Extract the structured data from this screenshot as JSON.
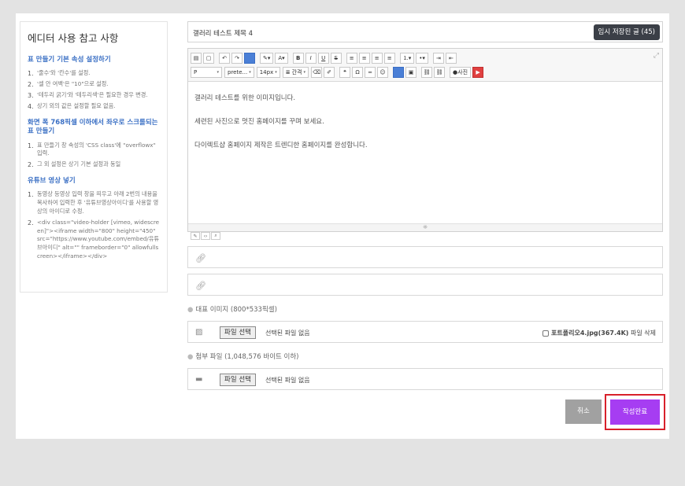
{
  "sidebar": {
    "title": "에디터 사용 참고 사항",
    "sections": [
      {
        "heading": "표 만들기 기본 속성 설정하기",
        "items": [
          "'줄수'와 '칸수'를 설정.",
          "'셀 안 여백'은 \"10\"으로 설정.",
          "'테두리 굵기'와 '테두리색'은 필요한 경우 변경.",
          "상기 외의 값은 설정할 필요 없음."
        ]
      },
      {
        "heading": "화면 폭 768픽셀 이하에서 좌우로 스크롤되는 표 만들기",
        "items": [
          "표 만들기 창 속성의 'CSS class'에 \"overflowx\" 입력.",
          "그 외 설정은 상기 기본 설정과 동일"
        ]
      },
      {
        "heading": "유튜브 영상 넣기",
        "items": [
          "동영상 등영상 입력 창을 띄우고 아래 2번의 내용을 복사하여 입력한 후 '유튜브영상아이디'를 사용할 영상의 아이디로 수정.",
          "<div class=\"video-holder [vimeo, widescreen]\"><iframe width=\"800\" height=\"450\" src=\"https://www.youtube.com/embed/유튜브아이디\" alt=\"\" frameborder=\"0\" allowfullscreen></iframe></div>"
        ]
      }
    ]
  },
  "form": {
    "title_value": "갤러리 테스트 제목 4",
    "temp_saved_label": "임시 저장된 글 (45)",
    "toolbar": {
      "format_select": "P",
      "font_select": "prete...",
      "size_select": "14px",
      "spacing_select": "간격",
      "photo_label": "사진"
    },
    "content_lines": [
      "갤러리 테스트를 위한 이미지입니다.",
      "세련된 사진으로 멋진 홈페이지를 꾸며 보세요.",
      "다이렉트샵 홈페이지 제작은 트렌디한 홈페이지를 완성합니다."
    ],
    "rep_image_label": "대표 이미지 (800*533픽셀)",
    "attach_label": "첨부 파일 (1,048,576 바이트 이하)",
    "file_button_label": "파일 선택",
    "no_file_text": "선택된 파일 없음",
    "existing_file_name": "포트폴리오4.jpg(367.4K)",
    "delete_file_label": "파일 삭제",
    "cancel_label": "취소",
    "submit_label": "작성완료"
  }
}
